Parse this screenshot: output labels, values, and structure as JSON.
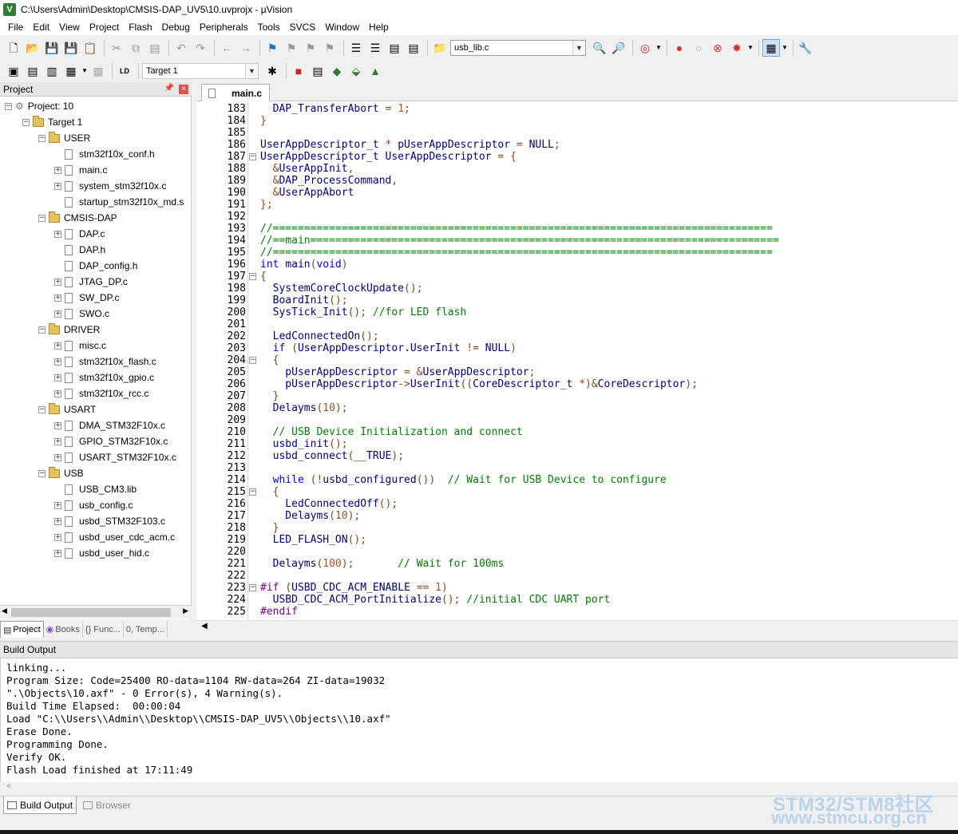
{
  "window": {
    "title": "C:\\Users\\Admin\\Desktop\\CMSIS-DAP_UV5\\10.uvprojx - µVision",
    "icon": "uvision-app-icon"
  },
  "menu": [
    "File",
    "Edit",
    "View",
    "Project",
    "Flash",
    "Debug",
    "Peripherals",
    "Tools",
    "SVCS",
    "Window",
    "Help"
  ],
  "toolbar1": {
    "find_combo_value": "usb_lib.c"
  },
  "toolbar2": {
    "target_combo_value": "Target 1"
  },
  "project_panel": {
    "title": "Project",
    "pin_icon": "pin-icon",
    "close_icon": "close-icon",
    "tree": [
      {
        "label": "Project: 10",
        "level": 0,
        "type": "project",
        "expander": "−"
      },
      {
        "label": "Target 1",
        "level": 1,
        "type": "target",
        "expander": "−"
      },
      {
        "label": "USER",
        "level": 2,
        "type": "folder",
        "expander": "−"
      },
      {
        "label": "stm32f10x_conf.h",
        "level": 3,
        "type": "file",
        "expander": ""
      },
      {
        "label": "main.c",
        "level": 3,
        "type": "file",
        "expander": "+"
      },
      {
        "label": "system_stm32f10x.c",
        "level": 3,
        "type": "file",
        "expander": "+"
      },
      {
        "label": "startup_stm32f10x_md.s",
        "level": 3,
        "type": "file",
        "expander": ""
      },
      {
        "label": "CMSIS-DAP",
        "level": 2,
        "type": "folder",
        "expander": "−"
      },
      {
        "label": "DAP.c",
        "level": 3,
        "type": "file",
        "expander": "+"
      },
      {
        "label": "DAP.h",
        "level": 3,
        "type": "file",
        "expander": ""
      },
      {
        "label": "DAP_config.h",
        "level": 3,
        "type": "file",
        "expander": ""
      },
      {
        "label": "JTAG_DP.c",
        "level": 3,
        "type": "file",
        "expander": "+"
      },
      {
        "label": "SW_DP.c",
        "level": 3,
        "type": "file",
        "expander": "+"
      },
      {
        "label": "SWO.c",
        "level": 3,
        "type": "file",
        "expander": "+"
      },
      {
        "label": "DRIVER",
        "level": 2,
        "type": "folder",
        "expander": "−"
      },
      {
        "label": "misc.c",
        "level": 3,
        "type": "file",
        "expander": "+"
      },
      {
        "label": "stm32f10x_flash.c",
        "level": 3,
        "type": "file",
        "expander": "+"
      },
      {
        "label": "stm32f10x_gpio.c",
        "level": 3,
        "type": "file",
        "expander": "+"
      },
      {
        "label": "stm32f10x_rcc.c",
        "level": 3,
        "type": "file",
        "expander": "+"
      },
      {
        "label": "USART",
        "level": 2,
        "type": "folder",
        "expander": "−"
      },
      {
        "label": "DMA_STM32F10x.c",
        "level": 3,
        "type": "file",
        "expander": "+"
      },
      {
        "label": "GPIO_STM32F10x.c",
        "level": 3,
        "type": "file",
        "expander": "+"
      },
      {
        "label": "USART_STM32F10x.c",
        "level": 3,
        "type": "file",
        "expander": "+"
      },
      {
        "label": "USB",
        "level": 2,
        "type": "folder",
        "expander": "−"
      },
      {
        "label": "USB_CM3.lib",
        "level": 3,
        "type": "file",
        "expander": ""
      },
      {
        "label": "usb_config.c",
        "level": 3,
        "type": "file",
        "expander": "+"
      },
      {
        "label": "usbd_STM32F103.c",
        "level": 3,
        "type": "file",
        "expander": "+"
      },
      {
        "label": "usbd_user_cdc_acm.c",
        "level": 3,
        "type": "file",
        "expander": "+"
      },
      {
        "label": "usbd_user_hid.c",
        "level": 3,
        "type": "file",
        "expander": "+"
      }
    ],
    "tabs": [
      "Project",
      "Books",
      "{} Func...",
      "0, Temp..."
    ]
  },
  "editor": {
    "tab_label": "main.c",
    "lines": [
      {
        "n": "183",
        "fold": "",
        "segs": [
          [
            "id",
            "  DAP_TransferAbort "
          ],
          [
            "op",
            "="
          ],
          [
            "id",
            " "
          ],
          [
            "nm",
            "1"
          ],
          [
            "op",
            ";"
          ]
        ]
      },
      {
        "n": "184",
        "fold": "",
        "segs": [
          [
            "op",
            "}"
          ]
        ]
      },
      {
        "n": "185",
        "fold": "",
        "segs": []
      },
      {
        "n": "186",
        "fold": "",
        "segs": [
          [
            "id",
            "UserAppDescriptor_t "
          ],
          [
            "op",
            "*"
          ],
          [
            "id",
            " pUserAppDescriptor "
          ],
          [
            "op",
            "="
          ],
          [
            "id",
            " NULL"
          ],
          [
            "op",
            ";"
          ]
        ]
      },
      {
        "n": "187",
        "fold": "−",
        "segs": [
          [
            "id",
            "UserAppDescriptor_t UserAppDescriptor "
          ],
          [
            "op",
            "= {"
          ]
        ]
      },
      {
        "n": "188",
        "fold": "",
        "segs": [
          [
            "op",
            "  &"
          ],
          [
            "id",
            "UserAppInit"
          ],
          [
            "op",
            ","
          ]
        ]
      },
      {
        "n": "189",
        "fold": "",
        "segs": [
          [
            "op",
            "  &"
          ],
          [
            "id",
            "DAP_ProcessCommand"
          ],
          [
            "op",
            ","
          ]
        ]
      },
      {
        "n": "190",
        "fold": "",
        "segs": [
          [
            "op",
            "  &"
          ],
          [
            "id",
            "UserAppAbort"
          ]
        ]
      },
      {
        "n": "191",
        "fold": "",
        "segs": [
          [
            "op",
            "};"
          ]
        ]
      },
      {
        "n": "192",
        "fold": "",
        "segs": []
      },
      {
        "n": "193",
        "fold": "",
        "segs": [
          [
            "cm",
            "//================================================================================"
          ]
        ]
      },
      {
        "n": "194",
        "fold": "",
        "segs": [
          [
            "cm",
            "//==main==========================================================================="
          ]
        ]
      },
      {
        "n": "195",
        "fold": "",
        "segs": [
          [
            "cm",
            "//================================================================================"
          ]
        ]
      },
      {
        "n": "196",
        "fold": "",
        "segs": [
          [
            "kw",
            "int"
          ],
          [
            "id",
            " main"
          ],
          [
            "op",
            "("
          ],
          [
            "kw",
            "void"
          ],
          [
            "op",
            ")"
          ]
        ]
      },
      {
        "n": "197",
        "fold": "−",
        "segs": [
          [
            "op",
            "{"
          ]
        ]
      },
      {
        "n": "198",
        "fold": "",
        "segs": [
          [
            "id",
            "  SystemCoreClockUpdate"
          ],
          [
            "op",
            "();"
          ]
        ]
      },
      {
        "n": "199",
        "fold": "",
        "segs": [
          [
            "id",
            "  BoardInit"
          ],
          [
            "op",
            "();"
          ]
        ]
      },
      {
        "n": "200",
        "fold": "",
        "segs": [
          [
            "id",
            "  SysTick_Init"
          ],
          [
            "op",
            "();"
          ],
          [
            "id",
            " "
          ],
          [
            "cm",
            "//for LED flash"
          ]
        ]
      },
      {
        "n": "201",
        "fold": "",
        "segs": []
      },
      {
        "n": "202",
        "fold": "",
        "segs": [
          [
            "id",
            "  LedConnectedOn"
          ],
          [
            "op",
            "();"
          ]
        ]
      },
      {
        "n": "203",
        "fold": "",
        "segs": [
          [
            "kw",
            "  if"
          ],
          [
            "id",
            " "
          ],
          [
            "op",
            "("
          ],
          [
            "id",
            "UserAppDescriptor.UserInit "
          ],
          [
            "op",
            "!="
          ],
          [
            "id",
            " NULL"
          ],
          [
            "op",
            ")"
          ]
        ]
      },
      {
        "n": "204",
        "fold": "−",
        "segs": [
          [
            "op",
            "  {"
          ]
        ]
      },
      {
        "n": "205",
        "fold": "",
        "segs": [
          [
            "id",
            "    pUserAppDescriptor "
          ],
          [
            "op",
            "= &"
          ],
          [
            "id",
            "UserAppDescriptor"
          ],
          [
            "op",
            ";"
          ]
        ]
      },
      {
        "n": "206",
        "fold": "",
        "segs": [
          [
            "id",
            "    pUserAppDescriptor"
          ],
          [
            "op",
            "->"
          ],
          [
            "id",
            "UserInit"
          ],
          [
            "op",
            "(("
          ],
          [
            "id",
            "CoreDescriptor_t "
          ],
          [
            "op",
            "*)&"
          ],
          [
            "id",
            "CoreDescriptor"
          ],
          [
            "op",
            ");"
          ]
        ]
      },
      {
        "n": "207",
        "fold": "",
        "segs": [
          [
            "op",
            "  }"
          ]
        ]
      },
      {
        "n": "208",
        "fold": "",
        "segs": [
          [
            "id",
            "  Delayms"
          ],
          [
            "op",
            "("
          ],
          [
            "nm",
            "10"
          ],
          [
            "op",
            ");"
          ]
        ]
      },
      {
        "n": "209",
        "fold": "",
        "segs": []
      },
      {
        "n": "210",
        "fold": "",
        "segs": [
          [
            "cm",
            "  // USB Device Initialization and connect"
          ]
        ]
      },
      {
        "n": "211",
        "fold": "",
        "segs": [
          [
            "id",
            "  usbd_init"
          ],
          [
            "op",
            "();"
          ]
        ]
      },
      {
        "n": "212",
        "fold": "",
        "segs": [
          [
            "id",
            "  usbd_connect"
          ],
          [
            "op",
            "("
          ],
          [
            "id",
            "__TRUE"
          ],
          [
            "op",
            ");"
          ]
        ]
      },
      {
        "n": "213",
        "fold": "",
        "segs": []
      },
      {
        "n": "214",
        "fold": "",
        "segs": [
          [
            "kw",
            "  while"
          ],
          [
            "id",
            " "
          ],
          [
            "op",
            "(!"
          ],
          [
            "id",
            "usbd_configured"
          ],
          [
            "op",
            "())"
          ],
          [
            "id",
            "  "
          ],
          [
            "cm",
            "// Wait for USB Device to configure"
          ]
        ]
      },
      {
        "n": "215",
        "fold": "−",
        "segs": [
          [
            "op",
            "  {"
          ]
        ]
      },
      {
        "n": "216",
        "fold": "",
        "segs": [
          [
            "id",
            "    LedConnectedOff"
          ],
          [
            "op",
            "();"
          ]
        ]
      },
      {
        "n": "217",
        "fold": "",
        "segs": [
          [
            "id",
            "    Delayms"
          ],
          [
            "op",
            "("
          ],
          [
            "nm",
            "10"
          ],
          [
            "op",
            ");"
          ]
        ]
      },
      {
        "n": "218",
        "fold": "",
        "segs": [
          [
            "op",
            "  }"
          ]
        ]
      },
      {
        "n": "219",
        "fold": "",
        "segs": [
          [
            "id",
            "  LED_FLASH_ON"
          ],
          [
            "op",
            "();"
          ]
        ]
      },
      {
        "n": "220",
        "fold": "",
        "segs": []
      },
      {
        "n": "221",
        "fold": "",
        "segs": [
          [
            "id",
            "  Delayms"
          ],
          [
            "op",
            "("
          ],
          [
            "nm",
            "100"
          ],
          [
            "op",
            ");"
          ],
          [
            "id",
            "       "
          ],
          [
            "cm",
            "// Wait for 100ms"
          ]
        ]
      },
      {
        "n": "222",
        "fold": "",
        "segs": []
      },
      {
        "n": "223",
        "fold": "−",
        "segs": [
          [
            "pp",
            "#if"
          ],
          [
            "id",
            " "
          ],
          [
            "op",
            "("
          ],
          [
            "id",
            "USBD_CDC_ACM_ENABLE "
          ],
          [
            "op",
            "=="
          ],
          [
            "id",
            " "
          ],
          [
            "nm",
            "1"
          ],
          [
            "op",
            ")"
          ]
        ]
      },
      {
        "n": "224",
        "fold": "",
        "segs": [
          [
            "id",
            "  USBD_CDC_ACM_PortInitialize"
          ],
          [
            "op",
            "();"
          ],
          [
            "id",
            " "
          ],
          [
            "cm",
            "//initial CDC UART port"
          ]
        ]
      },
      {
        "n": "225",
        "fold": "",
        "segs": [
          [
            "pp",
            "#endif"
          ]
        ]
      }
    ]
  },
  "build_output": {
    "title": "Build Output",
    "lines": [
      "linking...",
      "Program Size: Code=25400 RO-data=1104 RW-data=264 ZI-data=19032",
      "\".\\Objects\\10.axf\" - 0 Error(s), 4 Warning(s).",
      "Build Time Elapsed:  00:00:04",
      "Load \"C:\\\\Users\\\\Admin\\\\Desktop\\\\CMSIS-DAP_UV5\\\\Objects\\\\10.axf\"",
      "Erase Done.",
      "Programming Done.",
      "Verify OK.",
      "Flash Load finished at 17:11:49"
    ],
    "tabs": [
      "Build Output",
      "Browser"
    ]
  },
  "watermark": {
    "line1": "STM32/STM8社区",
    "line2": "www.stmcu.org.cn"
  },
  "colors": {
    "keyword": "#0000ff",
    "identifier": "#000080",
    "comment": "#008000",
    "operator": "#8b4513",
    "number": "#a0522d",
    "preprocessor": "#800080"
  }
}
